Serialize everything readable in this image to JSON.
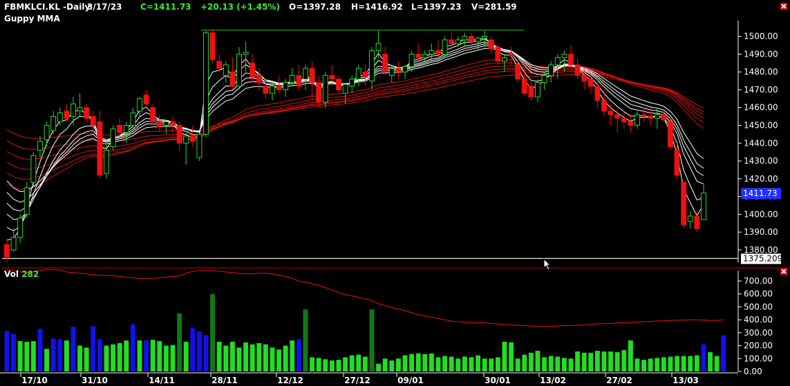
{
  "header": {
    "symbol": "FBMKLCI.KL -Daily",
    "date": "3/17/23",
    "close": "C=1411.73",
    "change": "+20.13 (+1.45%)",
    "open": "O=1397.28",
    "high": "H=1416.92",
    "low": "L=1397.23",
    "volume": "V=281.59"
  },
  "indicator_title": "Guppy MMA",
  "volume_panel": {
    "label": "Vol",
    "value": "282"
  },
  "colors": {
    "up": "#22dd22",
    "down": "#ee1111",
    "vol_up": "#22dd22",
    "vol_strong": "#117a11",
    "vol_blue": "#1111ee",
    "short_ma": "#ffffff",
    "long_ma": "#dd1111",
    "resistance": "#22cc22",
    "support": "#ffffff",
    "price_tag_bg": "#1f30ff"
  },
  "chart_data": [
    {
      "type": "candlestick",
      "title": "FBMKLCI.KL -Daily",
      "ylim": [
        1373,
        1508
      ],
      "yticks": [
        "1380.00",
        "1390.00",
        "1400.00",
        "1410.00",
        "1420.00",
        "1430.00",
        "1440.00",
        "1450.00",
        "1460.00",
        "1470.00",
        "1480.00",
        "1490.00",
        "1500.00"
      ],
      "xticks": [
        "17/10",
        "31/10",
        "14/11",
        "28/11",
        "12/12",
        "27/12",
        "09/01",
        "30/01",
        "13/02",
        "27/02",
        "13/03"
      ],
      "last_price_label": "1411.73",
      "support_label": "1375.209",
      "support_level": 1375.209,
      "resistance_level": 1503.5,
      "ohlc": [
        [
          1383,
          1386,
          1373,
          1376
        ],
        [
          1380,
          1392,
          1379,
          1387
        ],
        [
          1387,
          1400,
          1384,
          1398
        ],
        [
          1400,
          1418,
          1398,
          1415
        ],
        [
          1418,
          1435,
          1416,
          1433
        ],
        [
          1436,
          1444,
          1432,
          1441
        ],
        [
          1442,
          1452,
          1438,
          1450
        ],
        [
          1447,
          1458,
          1445,
          1455
        ],
        [
          1452,
          1460,
          1450,
          1457
        ],
        [
          1458,
          1462,
          1452,
          1454
        ],
        [
          1455,
          1466,
          1450,
          1462
        ],
        [
          1458,
          1468,
          1455,
          1460
        ],
        [
          1460,
          1462,
          1452,
          1454
        ],
        [
          1455,
          1458,
          1446,
          1450
        ],
        [
          1452,
          1458,
          1420,
          1422
        ],
        [
          1423,
          1440,
          1420,
          1436
        ],
        [
          1438,
          1450,
          1436,
          1448
        ],
        [
          1450,
          1454,
          1444,
          1446
        ],
        [
          1446,
          1452,
          1440,
          1450
        ],
        [
          1450,
          1460,
          1448,
          1457
        ],
        [
          1458,
          1466,
          1455,
          1465
        ],
        [
          1467,
          1470,
          1460,
          1462
        ],
        [
          1460,
          1462,
          1450,
          1452
        ],
        [
          1452,
          1456,
          1446,
          1449
        ],
        [
          1450,
          1453,
          1445,
          1452
        ],
        [
          1452,
          1455,
          1446,
          1450
        ],
        [
          1450,
          1452,
          1436,
          1440
        ],
        [
          1440,
          1446,
          1428,
          1444
        ],
        [
          1444,
          1450,
          1438,
          1441
        ],
        [
          1432,
          1446,
          1430,
          1445
        ],
        [
          1445,
          1503,
          1443,
          1502
        ],
        [
          1502,
          1504,
          1485,
          1487
        ],
        [
          1486,
          1490,
          1480,
          1482
        ],
        [
          1478,
          1486,
          1474,
          1484
        ],
        [
          1480,
          1488,
          1470,
          1472
        ],
        [
          1472,
          1494,
          1470,
          1490
        ],
        [
          1490,
          1497,
          1480,
          1491
        ],
        [
          1485,
          1490,
          1474,
          1477
        ],
        [
          1478,
          1482,
          1470,
          1474
        ],
        [
          1472,
          1476,
          1465,
          1468
        ],
        [
          1468,
          1474,
          1464,
          1472
        ],
        [
          1472,
          1478,
          1468,
          1470
        ],
        [
          1470,
          1476,
          1466,
          1474
        ],
        [
          1474,
          1482,
          1472,
          1478
        ],
        [
          1478,
          1484,
          1470,
          1472
        ],
        [
          1476,
          1484,
          1470,
          1482
        ],
        [
          1482,
          1486,
          1464,
          1474
        ],
        [
          1474,
          1478,
          1460,
          1463
        ],
        [
          1463,
          1480,
          1460,
          1478
        ],
        [
          1478,
          1484,
          1474,
          1476
        ],
        [
          1476,
          1478,
          1468,
          1470
        ],
        [
          1468,
          1474,
          1462,
          1473
        ],
        [
          1472,
          1478,
          1468,
          1476
        ],
        [
          1476,
          1484,
          1472,
          1482
        ],
        [
          1480,
          1484,
          1472,
          1477
        ],
        [
          1475,
          1494,
          1470,
          1492
        ],
        [
          1492,
          1503,
          1488,
          1496
        ],
        [
          1490,
          1494,
          1478,
          1480
        ],
        [
          1478,
          1484,
          1474,
          1482
        ],
        [
          1482,
          1486,
          1476,
          1480
        ],
        [
          1480,
          1484,
          1476,
          1483
        ],
        [
          1483,
          1492,
          1480,
          1490
        ],
        [
          1490,
          1496,
          1486,
          1488
        ],
        [
          1488,
          1492,
          1484,
          1490
        ],
        [
          1490,
          1496,
          1486,
          1492
        ],
        [
          1492,
          1498,
          1488,
          1490
        ],
        [
          1490,
          1500,
          1488,
          1498
        ],
        [
          1498,
          1502,
          1492,
          1496
        ],
        [
          1496,
          1500,
          1494,
          1498
        ],
        [
          1498,
          1502,
          1494,
          1500
        ],
        [
          1500,
          1502,
          1494,
          1497
        ],
        [
          1497,
          1500,
          1492,
          1499
        ],
        [
          1499,
          1503,
          1494,
          1500
        ],
        [
          1498,
          1500,
          1490,
          1493
        ],
        [
          1494,
          1496,
          1484,
          1486
        ],
        [
          1486,
          1490,
          1480,
          1488
        ],
        [
          1490,
          1494,
          1484,
          1489
        ],
        [
          1484,
          1486,
          1474,
          1476
        ],
        [
          1476,
          1482,
          1466,
          1468
        ],
        [
          1472,
          1476,
          1464,
          1466
        ],
        [
          1466,
          1476,
          1463,
          1474
        ],
        [
          1474,
          1480,
          1470,
          1478
        ],
        [
          1478,
          1486,
          1474,
          1484
        ],
        [
          1484,
          1490,
          1476,
          1488
        ],
        [
          1488,
          1492,
          1480,
          1490
        ],
        [
          1490,
          1495,
          1482,
          1484
        ],
        [
          1484,
          1488,
          1476,
          1478
        ],
        [
          1478,
          1482,
          1470,
          1475
        ],
        [
          1476,
          1478,
          1468,
          1472
        ],
        [
          1472,
          1476,
          1460,
          1464
        ],
        [
          1464,
          1470,
          1455,
          1458
        ],
        [
          1458,
          1462,
          1450,
          1456
        ],
        [
          1456,
          1460,
          1446,
          1454
        ],
        [
          1454,
          1458,
          1448,
          1452
        ],
        [
          1452,
          1456,
          1446,
          1450
        ],
        [
          1450,
          1458,
          1448,
          1456
        ],
        [
          1456,
          1460,
          1452,
          1455
        ],
        [
          1455,
          1460,
          1450,
          1454
        ],
        [
          1454,
          1460,
          1448,
          1456
        ],
        [
          1456,
          1458,
          1452,
          1453
        ],
        [
          1452,
          1454,
          1436,
          1438
        ],
        [
          1436,
          1440,
          1420,
          1422
        ],
        [
          1418,
          1420,
          1392,
          1394
        ],
        [
          1396,
          1402,
          1392,
          1399
        ],
        [
          1399,
          1402,
          1390,
          1392
        ],
        [
          1397,
          1417,
          1397,
          1412
        ]
      ],
      "guppy_short_last": [
        1416,
        1420,
        1423,
        1426,
        1429,
        1432
      ],
      "guppy_long_last": [
        1448,
        1451,
        1453,
        1455,
        1457,
        1459
      ]
    },
    {
      "type": "bar",
      "title": "Vol",
      "ylim": [
        0,
        780
      ],
      "yticks": [
        "0.00",
        "100.00",
        "200.00",
        "300.00",
        "400.00",
        "500.00",
        "600.00",
        "700.00"
      ],
      "values": [
        315,
        290,
        235,
        230,
        235,
        330,
        175,
        255,
        250,
        240,
        345,
        200,
        185,
        350,
        250,
        200,
        210,
        220,
        240,
        365,
        240,
        240,
        245,
        235,
        200,
        205,
        450,
        230,
        335,
        310,
        280,
        600,
        230,
        200,
        230,
        185,
        225,
        210,
        220,
        210,
        185,
        170,
        200,
        240,
        250,
        480,
        110,
        105,
        95,
        85,
        90,
        110,
        125,
        130,
        115,
        480,
        60,
        100,
        85,
        100,
        125,
        135,
        140,
        135,
        140,
        110,
        120,
        115,
        100,
        115,
        110,
        125,
        100,
        100,
        110,
        230,
        225,
        100,
        130,
        145,
        160,
        110,
        120,
        115,
        105,
        100,
        155,
        145,
        145,
        160,
        155,
        155,
        150,
        165,
        240,
        100,
        90,
        100,
        105,
        110,
        115,
        120,
        120,
        120,
        125,
        210,
        150,
        120,
        280
      ],
      "moving_average": [
        790,
        780,
        770,
        765,
        770,
        780,
        790,
        790,
        785,
        770,
        765,
        760,
        755,
        750,
        745,
        745,
        740,
        735,
        730,
        725,
        720,
        720,
        720,
        725,
        730,
        735,
        740,
        760,
        775,
        780,
        780,
        780,
        775,
        770,
        765,
        760,
        755,
        755,
        760,
        760,
        755,
        745,
        735,
        720,
        700,
        690,
        680,
        665,
        650,
        630,
        610,
        595,
        585,
        575,
        560,
        550,
        525,
        510,
        495,
        485,
        470,
        455,
        440,
        430,
        420,
        410,
        400,
        390,
        385,
        382,
        380,
        378,
        376,
        372,
        368,
        365,
        360,
        358,
        355,
        352,
        350,
        348,
        350,
        352,
        355,
        355,
        358,
        360,
        365,
        368,
        370,
        372,
        375,
        378,
        380,
        382,
        385,
        388,
        390,
        392,
        395,
        397,
        398,
        400,
        400,
        398,
        395,
        395,
        400
      ]
    }
  ]
}
